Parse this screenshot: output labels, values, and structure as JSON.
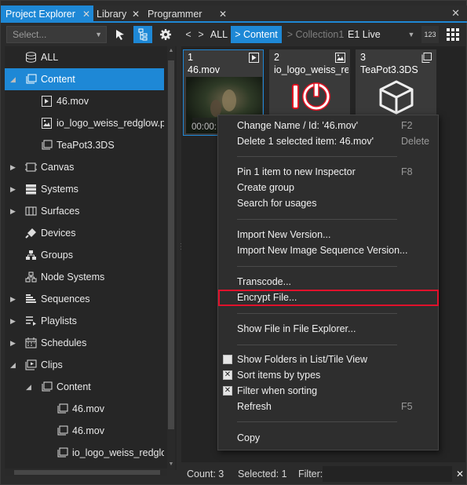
{
  "tabs": [
    {
      "label": "Project Explorer",
      "close": "✕"
    },
    {
      "label": "Library",
      "close": "✕"
    },
    {
      "label": "Programmer",
      "close": "✕"
    }
  ],
  "window_close": "✕",
  "left_toolbar": {
    "select_placeholder": "Select..."
  },
  "tree": {
    "items": [
      {
        "label": "ALL"
      },
      {
        "label": "Content"
      },
      {
        "label": "46.mov"
      },
      {
        "label": "io_logo_weiss_redglow.png"
      },
      {
        "label": "TeaPot3.3DS"
      },
      {
        "label": "Canvas"
      },
      {
        "label": "Systems"
      },
      {
        "label": "Surfaces"
      },
      {
        "label": "Devices"
      },
      {
        "label": "Groups"
      },
      {
        "label": "Node Systems"
      },
      {
        "label": "Sequences"
      },
      {
        "label": "Playlists"
      },
      {
        "label": "Schedules"
      },
      {
        "label": "Clips"
      },
      {
        "label": "Content"
      },
      {
        "label": "46.mov"
      },
      {
        "label": "46.mov"
      },
      {
        "label": "io_logo_weiss_redglow.png"
      }
    ]
  },
  "breadcrumb": {
    "back": "<",
    "forward": ">",
    "all": "ALL",
    "content": "> Content",
    "collection": "> Collection1",
    "live": "E1 Live",
    "view_mode": "123"
  },
  "tiles": [
    {
      "num": "1",
      "name": "46.mov",
      "time": "00:00:"
    },
    {
      "num": "2",
      "name": "io_logo_weiss_red..."
    },
    {
      "num": "3",
      "name": "TeaPot3.3DS"
    }
  ],
  "context_menu": {
    "change_name": "Change Name / Id: '46.mov'",
    "change_name_sc": "F2",
    "delete": "Delete 1 selected item: 46.mov'",
    "delete_sc": "Delete",
    "pin": "Pin 1 item to new Inspector",
    "pin_sc": "F8",
    "create_group": "Create group",
    "search_usages": "Search for usages",
    "import_version": "Import New Version...",
    "import_seq": "Import New Image Sequence Version...",
    "transcode": "Transcode...",
    "encrypt": "Encrypt File...",
    "show_explorer": "Show File in File Explorer...",
    "show_folders": "Show Folders in List/Tile View",
    "sort_types": "Sort items by types",
    "filter_sorting": "Filter when sorting",
    "refresh": "Refresh",
    "refresh_sc": "F5",
    "copy": "Copy"
  },
  "status": {
    "count": "Count: 3",
    "selected": "Selected: 1",
    "filter": "Filter:",
    "clear": "✕"
  },
  "colors": {
    "accent": "#1e88d6",
    "highlight": "#e0112b"
  }
}
